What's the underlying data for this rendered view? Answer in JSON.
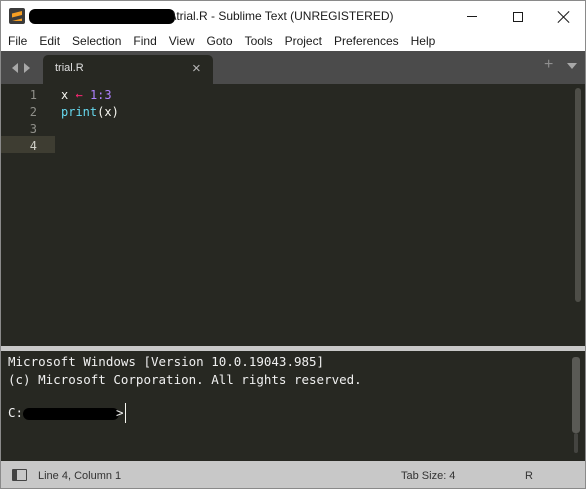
{
  "window": {
    "title": "\\trial.R - Sublime Text (UNREGISTERED)",
    "controls": [
      "minimize",
      "maximize",
      "close"
    ]
  },
  "menu": [
    "File",
    "Edit",
    "Selection",
    "Find",
    "View",
    "Goto",
    "Tools",
    "Project",
    "Preferences",
    "Help"
  ],
  "tabs": {
    "active_label": "trial.R",
    "close_glyph": "×",
    "new_tab_glyph": "+"
  },
  "editor": {
    "line_numbers": [
      "1",
      "2",
      "3",
      "4"
    ],
    "current_line": 4,
    "line1": {
      "var": "x",
      "op": "←",
      "value": "1:3"
    },
    "line2": {
      "fn": "print",
      "args": "(x)"
    },
    "colors": {
      "background": "#272822",
      "operator": "#f92672",
      "number": "#ae81ff",
      "function": "#66d9ef"
    }
  },
  "console": {
    "lines": [
      "Microsoft Windows [Version 10.0.19043.985]",
      "(c) Microsoft Corporation. All rights reserved."
    ],
    "prompt_start": "C:",
    "prompt_end": ">"
  },
  "status": {
    "position": "Line 4, Column 1",
    "tab_size": "Tab Size: 4",
    "syntax": "R"
  }
}
